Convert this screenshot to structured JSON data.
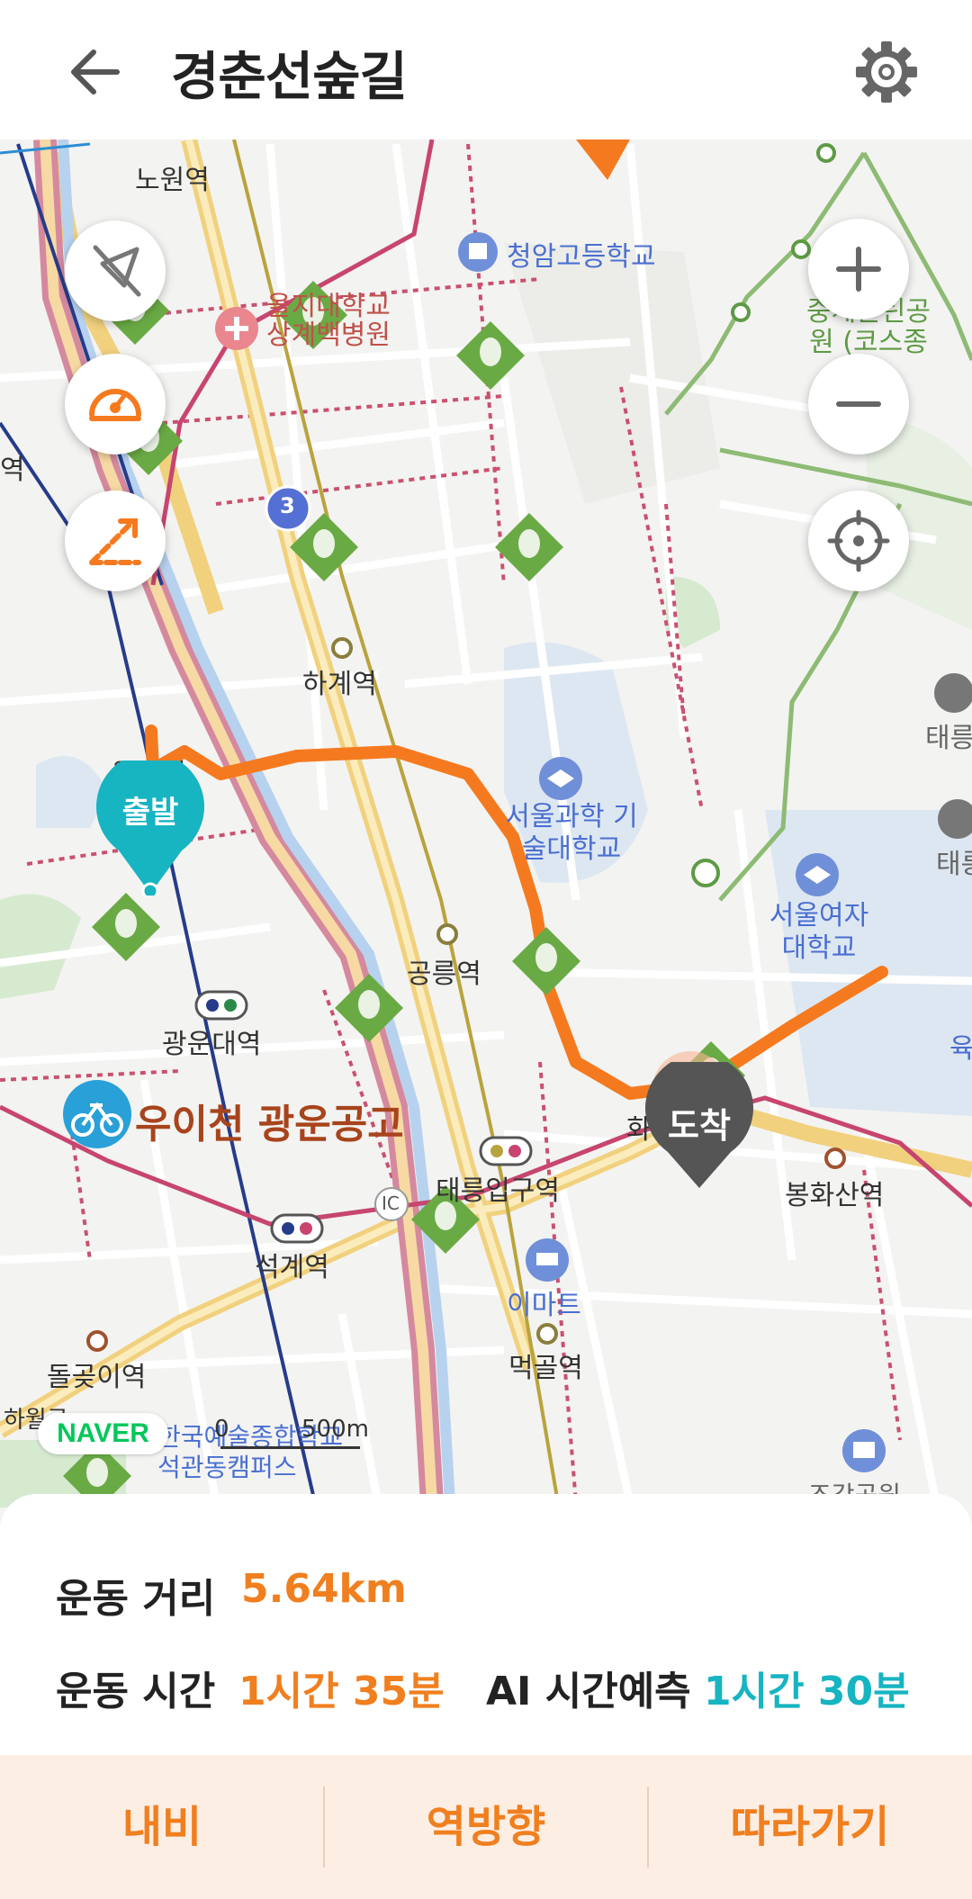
{
  "header": {
    "title": "경춘선숲길",
    "back_icon": "back-arrow-icon",
    "settings_icon": "gear-icon"
  },
  "map": {
    "labels": {
      "nowon": "노원역",
      "cheongam": "청암고등학교",
      "hospital": "을지대학교 상계백병원",
      "course": "중계근린공원 (코스종점)",
      "yeok": "역",
      "hagye": "하계역",
      "wolgye": "월계역",
      "seoultech": "서울과학 기술대학교",
      "swu": "서울여자 대학교",
      "gongneung": "공릉역",
      "gwangwoon": "광운대역",
      "uicheon": "우이천 광운공고",
      "hwarang": "화랑대역",
      "taereung": "태릉입구역",
      "bonghwasan": "봉화산역",
      "seokgye": "석계역",
      "emart": "이마트",
      "meokgol": "먹골역",
      "dolgoji": "돌곶이역",
      "hawolgok": "하월곡",
      "kart": "한국예술종합학교 석관동캠퍼스",
      "taereung_r1": "태릉",
      "taereung_r2": "태릉",
      "yuk": "육",
      "museum": "조각공원",
      "route3": "3",
      "ic": "IC"
    },
    "start_marker": "출발",
    "end_marker": "도착",
    "naver_logo": "NAVER",
    "scale_zero": "0",
    "scale_label": "500m",
    "left_controls": [
      "compass-off-icon",
      "speedometer-icon",
      "slope-icon"
    ],
    "right_controls": [
      "zoom-in-icon",
      "zoom-out-icon",
      "locate-icon"
    ],
    "colors": {
      "route": "#f57a1f",
      "start": "#17b4c2",
      "end": "#555555",
      "park": "#6aaa45"
    }
  },
  "stats": {
    "distance_label": "운동 거리",
    "distance_value": "5.64km",
    "time_label": "운동 시간",
    "time_value": "1시간 35분",
    "ai_label": "AI 시간예측",
    "ai_value": "1시간 30분"
  },
  "actions": {
    "navi": "내비",
    "reverse": "역방향",
    "follow": "따라가기"
  }
}
